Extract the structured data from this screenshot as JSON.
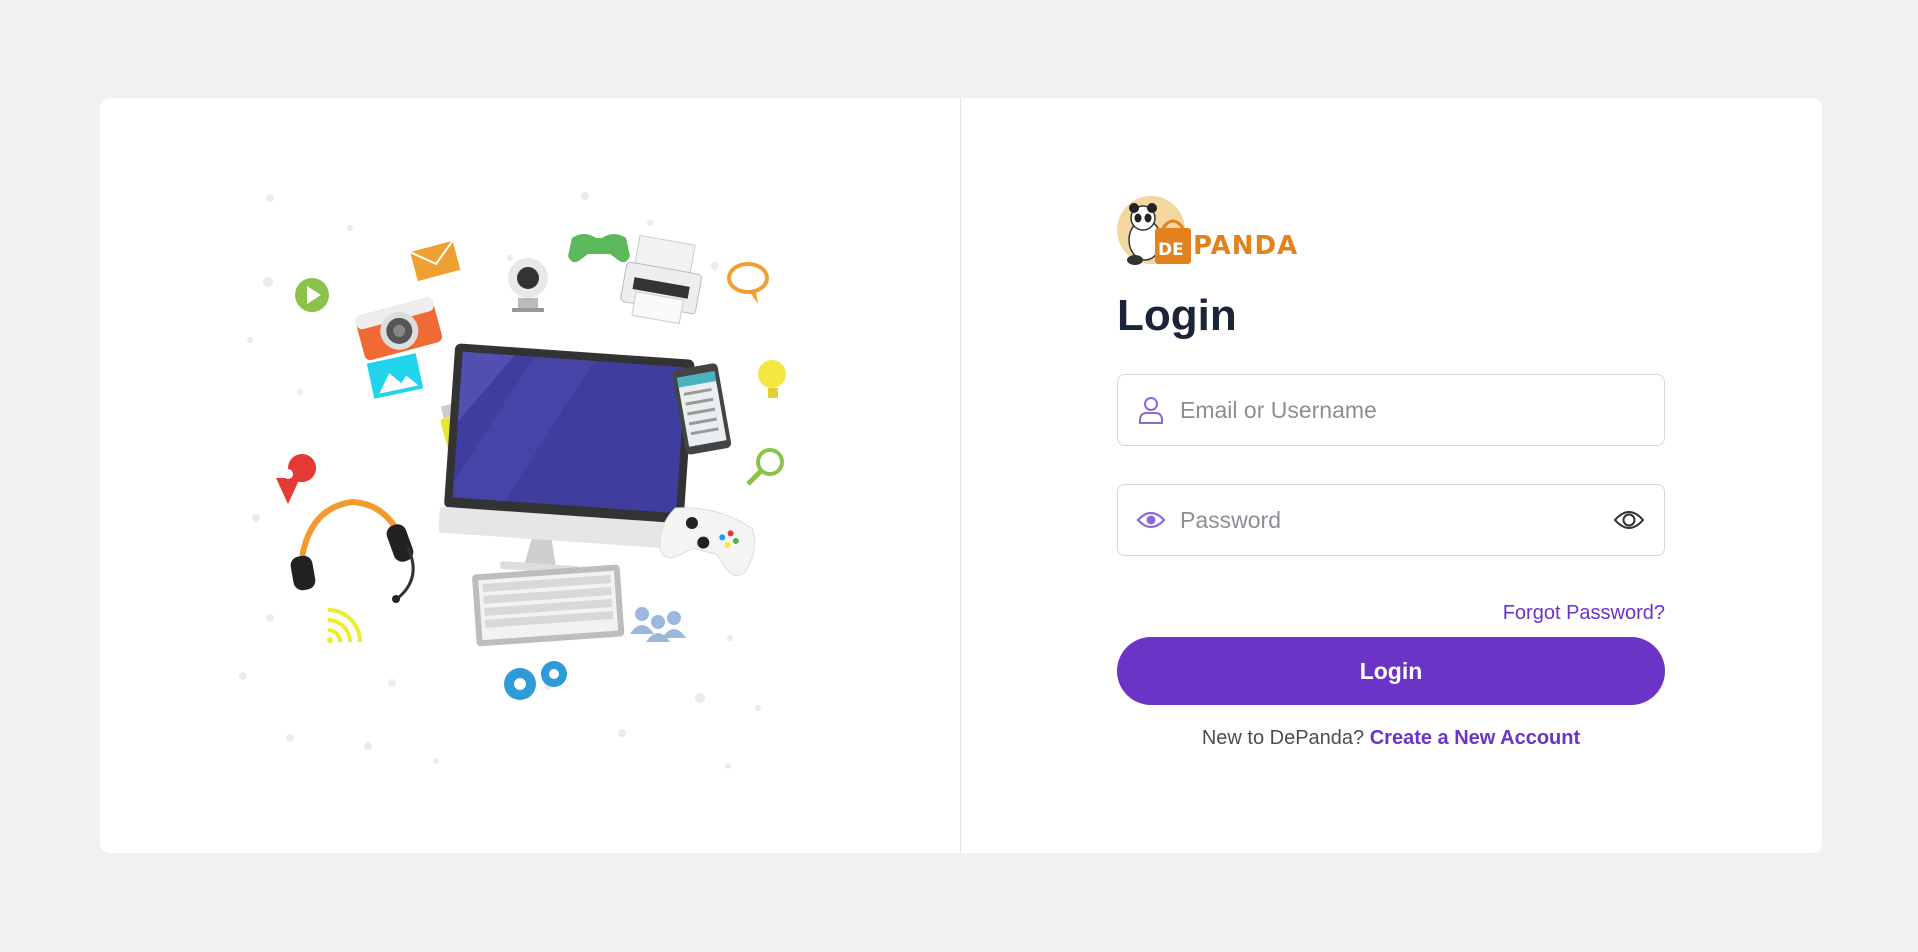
{
  "brand": {
    "logo_text": "PANDA",
    "logo_badge": "DE",
    "logo_icon": "panda-mascot-icon",
    "accent_color": "#6b33c6",
    "logo_color": "#e1821d"
  },
  "illustration": {
    "icon": "computer-devices-illustration"
  },
  "login": {
    "title": "Login",
    "username_placeholder": "Email or Username",
    "username_icon": "user-icon",
    "password_placeholder": "Password",
    "password_icon": "eye-icon",
    "password_toggle_icon": "eye-toggle-icon",
    "forgot_label": "Forgot Password?",
    "submit_label": "Login",
    "signup_prompt": "New to DePanda?",
    "signup_link": "Create a New Account"
  }
}
